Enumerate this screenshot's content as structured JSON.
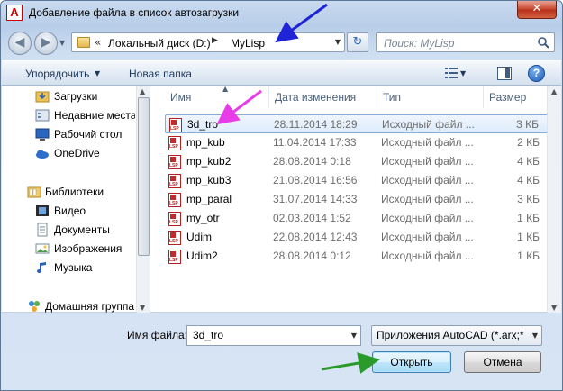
{
  "window": {
    "title": "Добавление файла в список автозагрузки",
    "app_icon_letter": "A",
    "close_label": "✕"
  },
  "address": {
    "prefix": "«",
    "crumbs": [
      "Локальный диск (D:)",
      "MyLisp"
    ],
    "separator": "▶",
    "dropdown": "▼",
    "refresh": "↻"
  },
  "search": {
    "placeholder": "Поиск: MyLisp"
  },
  "toolbar": {
    "organize_label": "Упорядочить",
    "organize_arrow": "▼",
    "new_folder_label": "Новая папка",
    "view_arrow": "▼",
    "help_label": "?"
  },
  "navpane": {
    "items": [
      {
        "label": "Загрузки",
        "icon": "downloads-folder-icon"
      },
      {
        "label": "Недавние места",
        "icon": "recent-places-icon"
      },
      {
        "label": "Рабочий стол",
        "icon": "desktop-icon"
      },
      {
        "label": "OneDrive",
        "icon": "onedrive-icon"
      },
      {
        "label": "Библиотеки",
        "icon": "libraries-icon"
      },
      {
        "label": "Видео",
        "icon": "video-icon"
      },
      {
        "label": "Документы",
        "icon": "documents-icon"
      },
      {
        "label": "Изображения",
        "icon": "pictures-icon"
      },
      {
        "label": "Музыка",
        "icon": "music-icon"
      },
      {
        "label": "Домашняя группа",
        "icon": "homegroup-icon"
      }
    ]
  },
  "filelist": {
    "columns": [
      "Имя",
      "Дата изменения",
      "Тип",
      "Размер"
    ],
    "sort_indicator": "▲",
    "rows": [
      {
        "name": "3d_tro",
        "date": "28.11.2014 18:29",
        "type": "Исходный файл ...",
        "size": "3 КБ",
        "selected": true
      },
      {
        "name": "mp_kub",
        "date": "11.04.2014 17:33",
        "type": "Исходный файл ...",
        "size": "2 КБ"
      },
      {
        "name": "mp_kub2",
        "date": "28.08.2014 0:18",
        "type": "Исходный файл ...",
        "size": "4 КБ"
      },
      {
        "name": "mp_kub3",
        "date": "21.08.2014 16:56",
        "type": "Исходный файл ...",
        "size": "4 КБ"
      },
      {
        "name": "mp_paral",
        "date": "31.07.2014 14:33",
        "type": "Исходный файл ...",
        "size": "3 КБ"
      },
      {
        "name": "my_otr",
        "date": "02.03.2014 1:52",
        "type": "Исходный файл ...",
        "size": "1 КБ"
      },
      {
        "name": "Udim",
        "date": "22.08.2014 12:43",
        "type": "Исходный файл ...",
        "size": "1 КБ"
      },
      {
        "name": "Udim2",
        "date": "28.08.2014 0:12",
        "type": "Исходный файл ...",
        "size": "1 КБ"
      }
    ]
  },
  "bottom": {
    "filename_label": "Имя файла:",
    "filename_value": "3d_tro",
    "filetype_value": "Приложения AutoCAD (*.arx;*",
    "open_label": "Открыть",
    "cancel_label": "Отмена"
  },
  "annotation_colors": {
    "blue_arrow": "#1f25d6",
    "magenta_arrow": "#e83ce8",
    "green_arrow": "#2a9a2a"
  }
}
